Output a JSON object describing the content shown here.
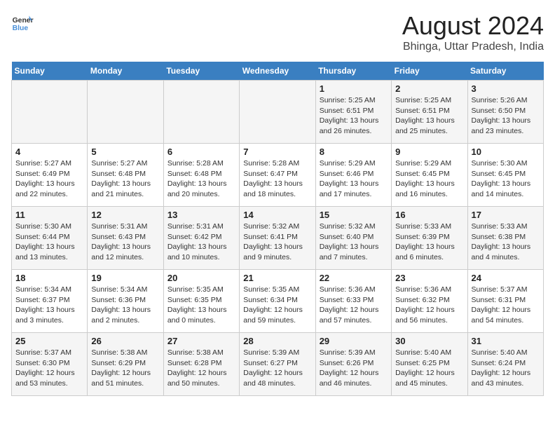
{
  "logo": {
    "text_general": "General",
    "text_blue": "Blue"
  },
  "title": "August 2024",
  "subtitle": "Bhinga, Uttar Pradesh, India",
  "days_of_week": [
    "Sunday",
    "Monday",
    "Tuesday",
    "Wednesday",
    "Thursday",
    "Friday",
    "Saturday"
  ],
  "weeks": [
    [
      {
        "day": "",
        "info": ""
      },
      {
        "day": "",
        "info": ""
      },
      {
        "day": "",
        "info": ""
      },
      {
        "day": "",
        "info": ""
      },
      {
        "day": "1",
        "info": "Sunrise: 5:25 AM\nSunset: 6:51 PM\nDaylight: 13 hours\nand 26 minutes."
      },
      {
        "day": "2",
        "info": "Sunrise: 5:25 AM\nSunset: 6:51 PM\nDaylight: 13 hours\nand 25 minutes."
      },
      {
        "day": "3",
        "info": "Sunrise: 5:26 AM\nSunset: 6:50 PM\nDaylight: 13 hours\nand 23 minutes."
      }
    ],
    [
      {
        "day": "4",
        "info": "Sunrise: 5:27 AM\nSunset: 6:49 PM\nDaylight: 13 hours\nand 22 minutes."
      },
      {
        "day": "5",
        "info": "Sunrise: 5:27 AM\nSunset: 6:48 PM\nDaylight: 13 hours\nand 21 minutes."
      },
      {
        "day": "6",
        "info": "Sunrise: 5:28 AM\nSunset: 6:48 PM\nDaylight: 13 hours\nand 20 minutes."
      },
      {
        "day": "7",
        "info": "Sunrise: 5:28 AM\nSunset: 6:47 PM\nDaylight: 13 hours\nand 18 minutes."
      },
      {
        "day": "8",
        "info": "Sunrise: 5:29 AM\nSunset: 6:46 PM\nDaylight: 13 hours\nand 17 minutes."
      },
      {
        "day": "9",
        "info": "Sunrise: 5:29 AM\nSunset: 6:45 PM\nDaylight: 13 hours\nand 16 minutes."
      },
      {
        "day": "10",
        "info": "Sunrise: 5:30 AM\nSunset: 6:45 PM\nDaylight: 13 hours\nand 14 minutes."
      }
    ],
    [
      {
        "day": "11",
        "info": "Sunrise: 5:30 AM\nSunset: 6:44 PM\nDaylight: 13 hours\nand 13 minutes."
      },
      {
        "day": "12",
        "info": "Sunrise: 5:31 AM\nSunset: 6:43 PM\nDaylight: 13 hours\nand 12 minutes."
      },
      {
        "day": "13",
        "info": "Sunrise: 5:31 AM\nSunset: 6:42 PM\nDaylight: 13 hours\nand 10 minutes."
      },
      {
        "day": "14",
        "info": "Sunrise: 5:32 AM\nSunset: 6:41 PM\nDaylight: 13 hours\nand 9 minutes."
      },
      {
        "day": "15",
        "info": "Sunrise: 5:32 AM\nSunset: 6:40 PM\nDaylight: 13 hours\nand 7 minutes."
      },
      {
        "day": "16",
        "info": "Sunrise: 5:33 AM\nSunset: 6:39 PM\nDaylight: 13 hours\nand 6 minutes."
      },
      {
        "day": "17",
        "info": "Sunrise: 5:33 AM\nSunset: 6:38 PM\nDaylight: 13 hours\nand 4 minutes."
      }
    ],
    [
      {
        "day": "18",
        "info": "Sunrise: 5:34 AM\nSunset: 6:37 PM\nDaylight: 13 hours\nand 3 minutes."
      },
      {
        "day": "19",
        "info": "Sunrise: 5:34 AM\nSunset: 6:36 PM\nDaylight: 13 hours\nand 2 minutes."
      },
      {
        "day": "20",
        "info": "Sunrise: 5:35 AM\nSunset: 6:35 PM\nDaylight: 13 hours\nand 0 minutes."
      },
      {
        "day": "21",
        "info": "Sunrise: 5:35 AM\nSunset: 6:34 PM\nDaylight: 12 hours\nand 59 minutes."
      },
      {
        "day": "22",
        "info": "Sunrise: 5:36 AM\nSunset: 6:33 PM\nDaylight: 12 hours\nand 57 minutes."
      },
      {
        "day": "23",
        "info": "Sunrise: 5:36 AM\nSunset: 6:32 PM\nDaylight: 12 hours\nand 56 minutes."
      },
      {
        "day": "24",
        "info": "Sunrise: 5:37 AM\nSunset: 6:31 PM\nDaylight: 12 hours\nand 54 minutes."
      }
    ],
    [
      {
        "day": "25",
        "info": "Sunrise: 5:37 AM\nSunset: 6:30 PM\nDaylight: 12 hours\nand 53 minutes."
      },
      {
        "day": "26",
        "info": "Sunrise: 5:38 AM\nSunset: 6:29 PM\nDaylight: 12 hours\nand 51 minutes."
      },
      {
        "day": "27",
        "info": "Sunrise: 5:38 AM\nSunset: 6:28 PM\nDaylight: 12 hours\nand 50 minutes."
      },
      {
        "day": "28",
        "info": "Sunrise: 5:39 AM\nSunset: 6:27 PM\nDaylight: 12 hours\nand 48 minutes."
      },
      {
        "day": "29",
        "info": "Sunrise: 5:39 AM\nSunset: 6:26 PM\nDaylight: 12 hours\nand 46 minutes."
      },
      {
        "day": "30",
        "info": "Sunrise: 5:40 AM\nSunset: 6:25 PM\nDaylight: 12 hours\nand 45 minutes."
      },
      {
        "day": "31",
        "info": "Sunrise: 5:40 AM\nSunset: 6:24 PM\nDaylight: 12 hours\nand 43 minutes."
      }
    ]
  ]
}
